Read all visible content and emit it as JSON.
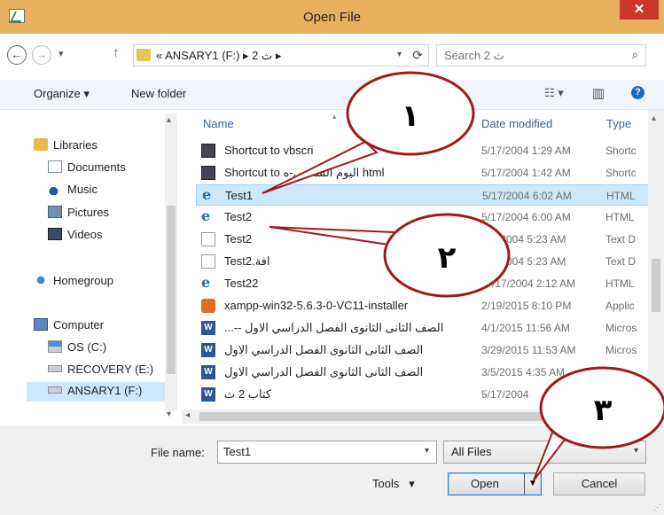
{
  "window": {
    "title": "Open File",
    "close_glyph": "✕",
    "close_color": "#c7392c",
    "title_bar_color": "#e7b05c"
  },
  "navigation": {
    "back_glyph": "←",
    "forward_glyph": "→",
    "recent_glyph": "▾",
    "up_glyph": "↑",
    "path": "« ANSARY1 (F:) ▸ ث 2 ▸",
    "search_placeholder": "Search ث 2"
  },
  "toolbar": {
    "organize_label": "Organize ▾",
    "new_folder_label": "New folder",
    "view_glyph": "☷ ▾",
    "pane_glyph": "▥",
    "help_glyph": "?"
  },
  "nav_pane": {
    "items": [
      {
        "label": "Libraries",
        "icon": "libraries-icon"
      },
      {
        "label": "Documents",
        "icon": "documents-icon"
      },
      {
        "label": "Music",
        "icon": "music-icon"
      },
      {
        "label": "Pictures",
        "icon": "pictures-icon"
      },
      {
        "label": "Videos",
        "icon": "videos-icon"
      },
      {
        "label": "Homegroup",
        "icon": "homegroup-icon"
      },
      {
        "label": "Computer",
        "icon": "computer-icon"
      },
      {
        "label": "OS (C:)",
        "icon": "os-drive-icon"
      },
      {
        "label": "RECOVERY (E:)",
        "icon": "drive-icon"
      },
      {
        "label": "ANSARY1 (F:)",
        "icon": "drive-icon",
        "selected": true
      }
    ]
  },
  "file_list": {
    "columns": {
      "name": "Name",
      "date": "Date modified",
      "type": "Type"
    },
    "rows": [
      {
        "name": "Shortcut to vbscri",
        "date": "5/17/2004 1:29 AM",
        "type": "Shortc",
        "icon": "shortcut-icon"
      },
      {
        "name": "Shortcut to اليوم السادس-ه html",
        "date": "5/17/2004 1:42 AM",
        "type": "Shortc",
        "icon": "shortcut-icon"
      },
      {
        "name": "Test1",
        "date": "5/17/2004 6:02 AM",
        "type": "HTML",
        "icon": "html-file-icon",
        "selected": true
      },
      {
        "name": "Test2",
        "date": "5/17/2004 6:00 AM",
        "type": "HTML",
        "icon": "html-file-icon"
      },
      {
        "name": "Test2",
        "date": "/2004 5:23 AM",
        "type": "Text D",
        "icon": "text-file-icon"
      },
      {
        "name": "Test2.افة",
        "date": "/2004 5:23 AM",
        "type": "Text D",
        "icon": "text-file-icon"
      },
      {
        "name": "Test22",
        "date": "/17/2004 2:12 AM",
        "type": "HTML",
        "icon": "html-file-icon"
      },
      {
        "name": "xampp-win32-5.6.3-0-VC11-installer",
        "date": "2/19/2015 8:10 PM",
        "type": "Applic",
        "icon": "installer-icon"
      },
      {
        "name": "...-- الصف الثانى الثانوى الفصل الدراسي الاول",
        "date": "4/1/2015 11:56 AM",
        "type": "Micros",
        "icon": "word-doc-icon"
      },
      {
        "name": "الصف الثانى الثانوى الفصل الدراسي الاول",
        "date": "3/29/2015 11:53 AM",
        "type": "Micros",
        "icon": "word-doc-icon"
      },
      {
        "name": "الصف الثانى الثانوى الفصل الدراسي الاول",
        "date": "3/5/2015 4:35 AM",
        "type": "",
        "icon": "word-doc-icon"
      },
      {
        "name": "كتاب 2 ث",
        "date": "5/17/2004",
        "type": "",
        "icon": "word-doc-icon"
      }
    ]
  },
  "footer": {
    "file_name_label": "File name:",
    "file_name_value": "Test1",
    "filter_value": "All Files",
    "tools_label": "Tools",
    "open_label": "Open",
    "cancel_label": "Cancel"
  },
  "callouts": [
    {
      "label": "١"
    },
    {
      "label": "٢"
    },
    {
      "label": "٣"
    }
  ]
}
